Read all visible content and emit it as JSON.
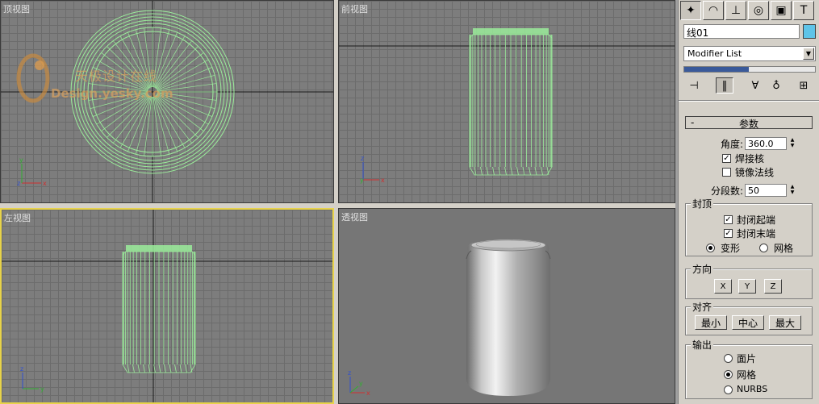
{
  "viewports": {
    "top": {
      "label": "顶视图"
    },
    "front": {
      "label": "前视图"
    },
    "left": {
      "label": "左视图"
    },
    "persp": {
      "label": "透视图"
    }
  },
  "watermark": {
    "line1": "天极设计在线",
    "line2": "Design.yesky.com"
  },
  "axes": {
    "x": "x",
    "y": "y",
    "z": "z"
  },
  "panel": {
    "object_name": "线01",
    "object_color": "#5ec4e8",
    "modifier_list": "Modifier List",
    "rollout_minus": "-",
    "rollout_title": "参数",
    "angle_label": "角度:",
    "angle_value": "360.0",
    "weld_core": "焊接核",
    "weld_core_checked": true,
    "flip_normals": "镜像法线",
    "flip_normals_checked": false,
    "segments_label": "分段数:",
    "segments_value": "50",
    "capping": {
      "title": "封顶",
      "cap_start": "封闭起端",
      "cap_end": "封闭末端",
      "morph": "变形",
      "grid": "网格",
      "selected": "变形"
    },
    "direction": {
      "title": "方向",
      "x": "X",
      "y": "Y",
      "z": "Z"
    },
    "align": {
      "title": "对齐",
      "min": "最小",
      "center": "中心",
      "max": "最大"
    },
    "output": {
      "title": "输出",
      "patch": "面片",
      "mesh": "网格",
      "nurbs": "NURBS",
      "selected": "网格"
    }
  },
  "colors": {
    "wireframe": "#9aec9a",
    "active_border": "#e8d34a",
    "viewport_bg": "#7d7d7d"
  }
}
